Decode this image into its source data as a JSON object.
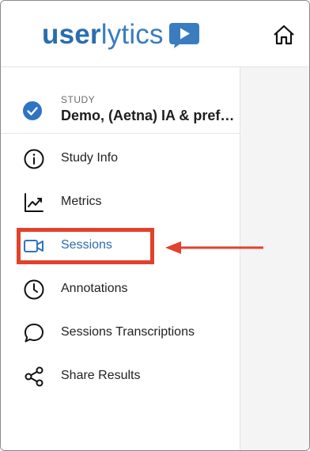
{
  "brand": {
    "logo_part1": "user",
    "logo_part2": "lytics",
    "color": "#2b6cb0"
  },
  "header": {
    "home_icon": "home-icon"
  },
  "study": {
    "label": "STUDY",
    "name": "Demo, (Aetna) IA & preferences",
    "status_icon": "check-circle-icon"
  },
  "nav": {
    "items": [
      {
        "label": "Study Info",
        "icon": "info-circle-icon"
      },
      {
        "label": "Metrics",
        "icon": "chart-line-icon"
      },
      {
        "label": "Sessions",
        "icon": "video-camera-icon",
        "active": true
      },
      {
        "label": "Annotations",
        "icon": "clock-icon"
      },
      {
        "label": "Sessions Transcriptions",
        "icon": "speech-bubble-icon"
      },
      {
        "label": "Share Results",
        "icon": "share-icon"
      }
    ]
  },
  "annotation": {
    "highlight_color": "#e2412b",
    "arrow_icon": "left-arrow-icon"
  }
}
